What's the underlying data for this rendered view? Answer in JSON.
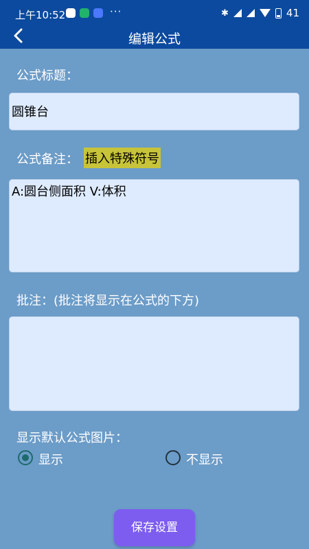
{
  "status_bar": {
    "time": "上午10:52",
    "dots": "···",
    "battery": "41",
    "bluetooth": "✱",
    "notification_colors": [
      "#ffffff",
      "#21b36b",
      "#4a78ff"
    ]
  },
  "toolbar": {
    "title": "编辑公式",
    "back_icon": "chevron-left-icon"
  },
  "form": {
    "title_label": "公式标题：",
    "title_value": "圆锥台",
    "note_label": "公式备注：",
    "insert_symbol_button": "插入特殊符号",
    "note_value": "A:圆台侧面积  V:体积",
    "comment_label": "批注：(批注将显示在公式的下方)",
    "comment_value": "",
    "default_image_label": "显示默认公式图片：",
    "options": [
      {
        "label": "显示",
        "selected": true
      },
      {
        "label": "不显示",
        "selected": false
      }
    ]
  },
  "save_button": "保存设置",
  "colors": {
    "background": "#6c9cc8",
    "header": "#0b4a9e",
    "input_bg": "#deebff",
    "highlight": "#c8c43a",
    "save_button": "#7d5cf0"
  }
}
